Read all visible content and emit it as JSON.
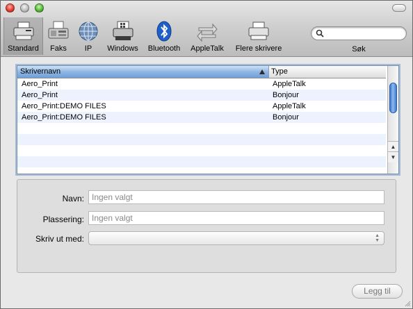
{
  "toolbar": {
    "tools": [
      {
        "label": "Standard",
        "icon": "printer-standard-icon"
      },
      {
        "label": "Faks",
        "icon": "fax-icon"
      },
      {
        "label": "IP",
        "icon": "globe-ip-icon"
      },
      {
        "label": "Windows",
        "icon": "windows-printer-icon"
      },
      {
        "label": "Bluetooth",
        "icon": "bluetooth-icon"
      },
      {
        "label": "AppleTalk",
        "icon": "appletalk-arrows-icon"
      },
      {
        "label": "Flere skrivere",
        "icon": "more-printers-icon"
      }
    ],
    "selected": "Standard",
    "search": {
      "placeholder": "",
      "value": "",
      "label": "Søk"
    }
  },
  "table": {
    "columns": [
      {
        "label": "Skrivernavn",
        "sorted": "ascending"
      },
      {
        "label": "Type"
      }
    ],
    "rows": [
      {
        "name": "Aero_Print",
        "type": "AppleTalk"
      },
      {
        "name": "Aero_Print",
        "type": "Bonjour"
      },
      {
        "name": "Aero_Print:DEMO FILES",
        "type": "AppleTalk"
      },
      {
        "name": "Aero_Print:DEMO FILES",
        "type": "Bonjour"
      },
      {
        "name": "",
        "type": ""
      },
      {
        "name": "",
        "type": ""
      },
      {
        "name": "",
        "type": ""
      },
      {
        "name": "",
        "type": ""
      }
    ]
  },
  "details": {
    "name_label": "Navn:",
    "name_value": "Ingen valgt",
    "location_label": "Plassering:",
    "location_value": "Ingen valgt",
    "print_using_label": "Skriv ut med:",
    "print_using_value": ""
  },
  "add_button": {
    "label": "Legg til"
  },
  "colors": {
    "selection_header": "#8fb6e3",
    "alt_row": "#edf3fe",
    "focus_ring": "#a5bcd8"
  }
}
